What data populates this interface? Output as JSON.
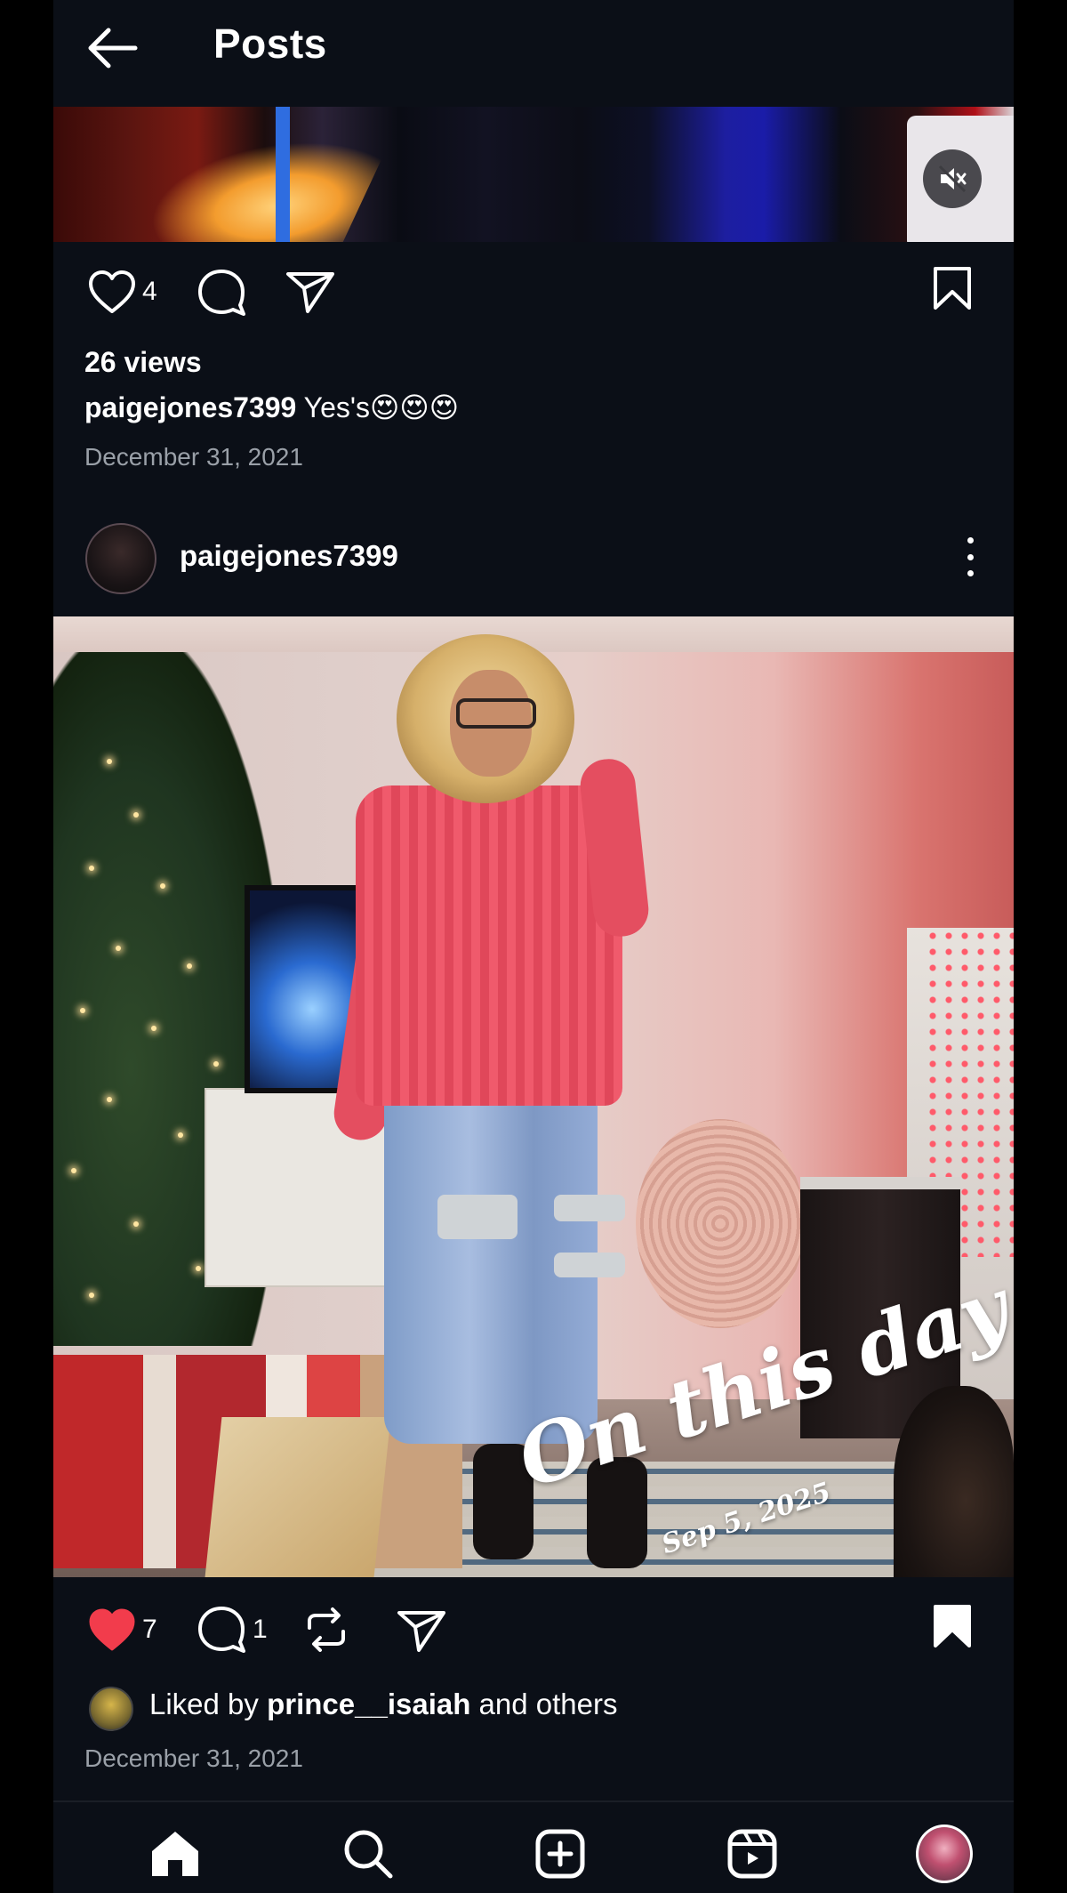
{
  "header": {
    "title": "Posts"
  },
  "prev_post": {
    "likes": "4",
    "views": "26 views",
    "caption_user": "paigejones7399",
    "caption_text": "Yes's😍😍😍",
    "date": "December 31, 2021"
  },
  "post": {
    "username": "paigejones7399",
    "overlay_title": "On this day",
    "overlay_date": "Sep 5, 2025",
    "likes": "7",
    "comments": "1",
    "liked_prefix": "Liked by ",
    "liked_user": "prince__isaiah",
    "liked_suffix": " and others",
    "date": "December 31, 2021"
  },
  "colors": {
    "like_active": "#f23c4c",
    "background": "#0b0f17",
    "muted_text": "#9aa0a8"
  }
}
